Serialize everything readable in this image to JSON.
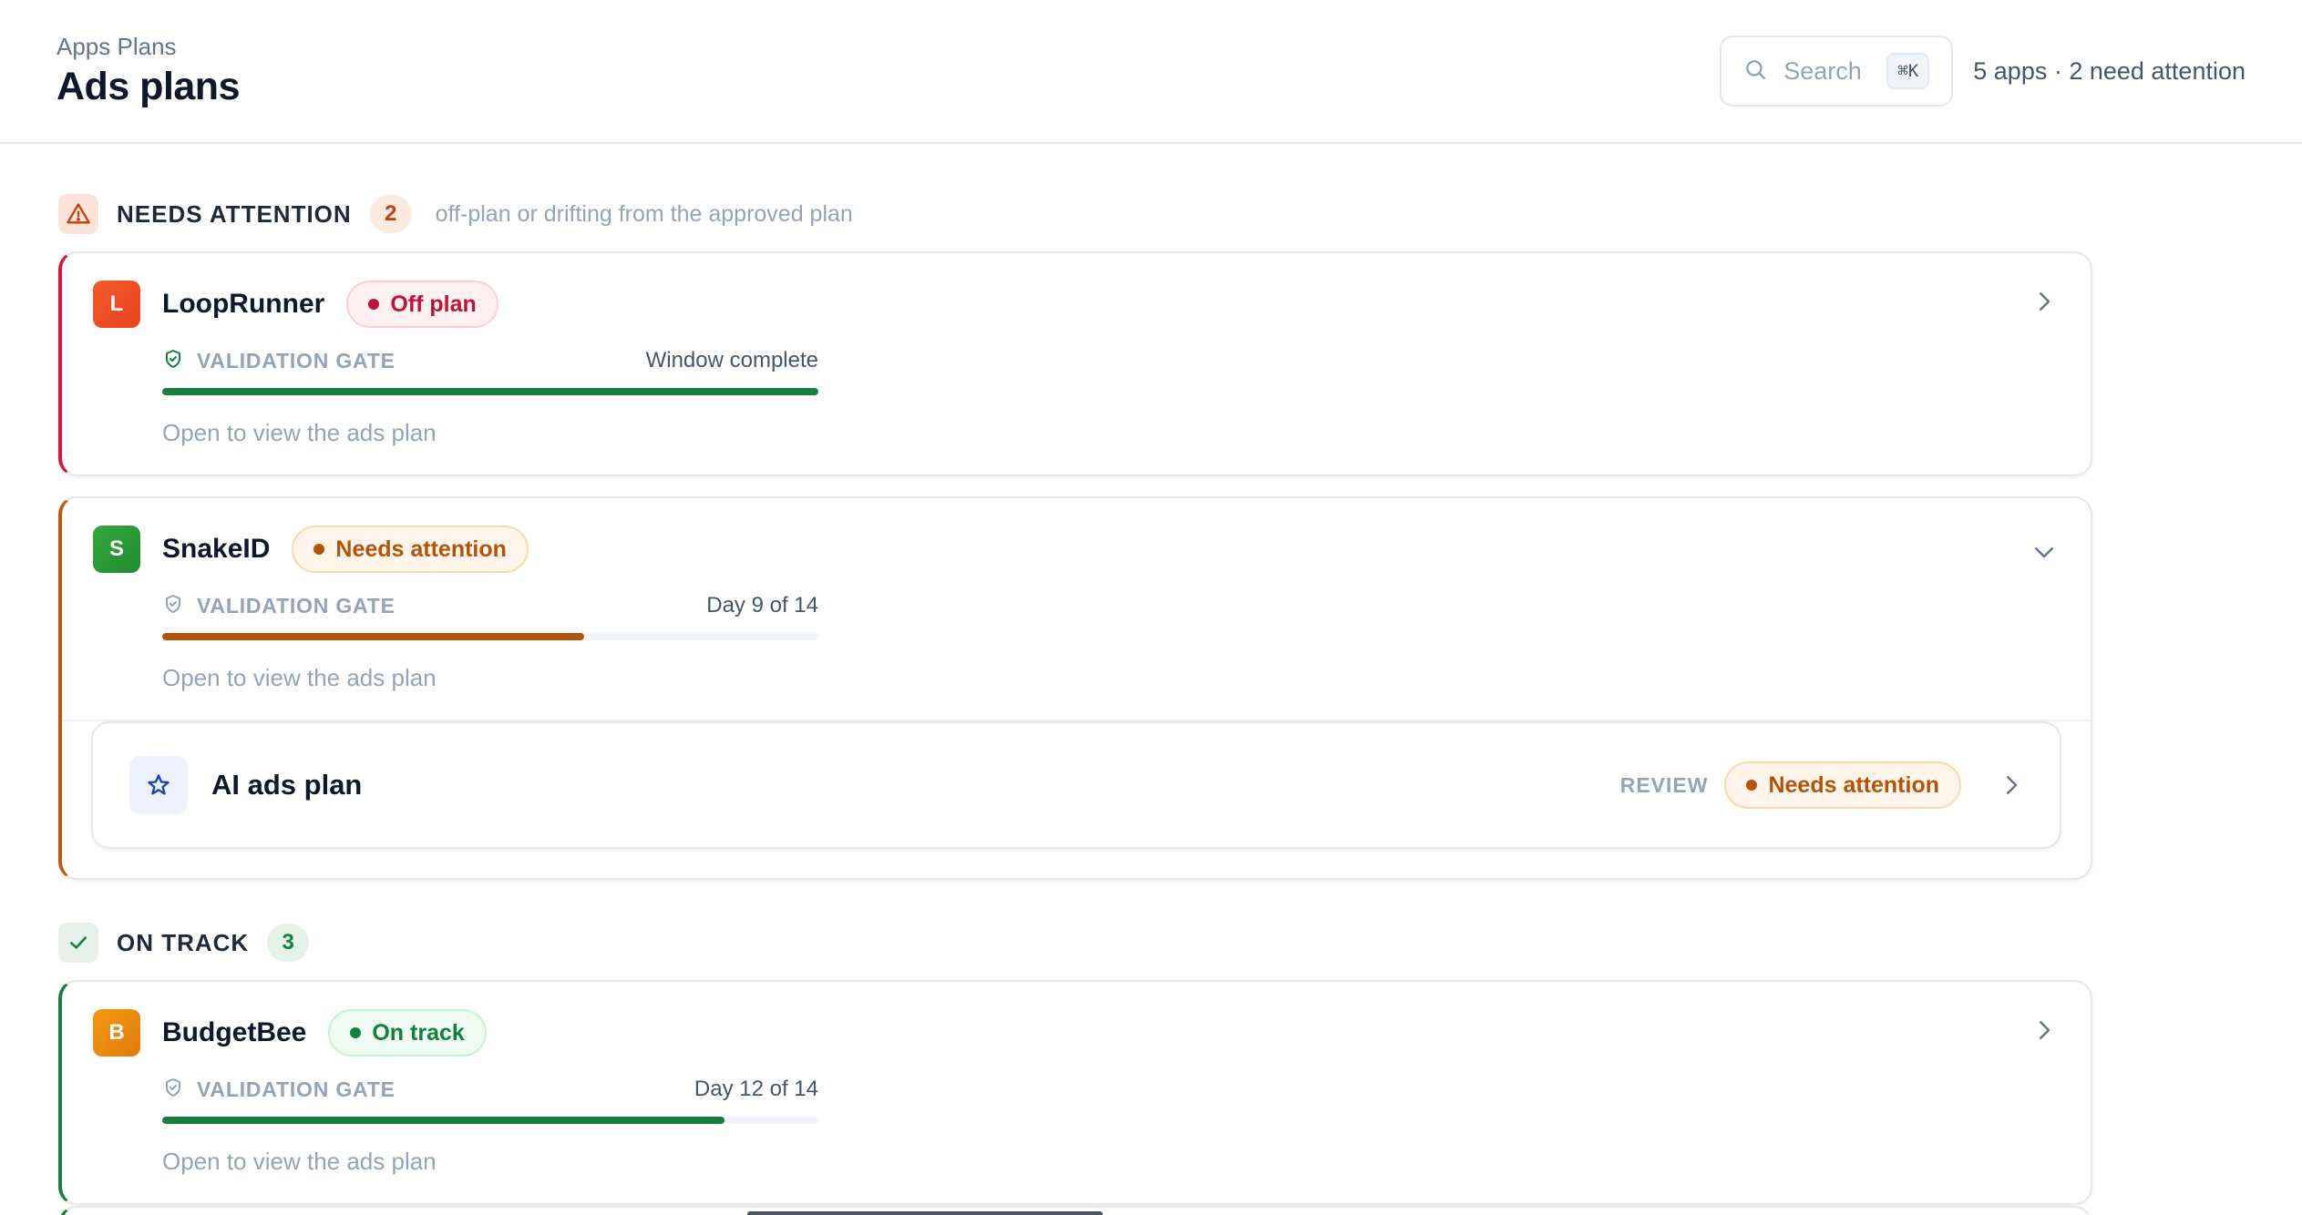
{
  "header": {
    "breadcrumb": "Apps Plans",
    "title": "Ads plans",
    "search_placeholder": "Search",
    "search_shortcut": "⌘K",
    "summary": "5 apps · 2 need attention"
  },
  "sections": {
    "attention": {
      "label": "NEEDS ATTENTION",
      "count": "2",
      "description": "off-plan or drifting from the approved plan"
    },
    "on_track": {
      "label": "ON TRACK",
      "count": "3"
    }
  },
  "apps": [
    {
      "initial": "L",
      "name": "LoopRunner",
      "status": "Off plan",
      "gate_label": "VALIDATION GATE",
      "gate_status": "Window complete",
      "progress": 1.0,
      "hint": "Open to view the ads plan",
      "icon_color": "#f0532b"
    },
    {
      "initial": "S",
      "name": "SnakeID",
      "status": "Needs attention",
      "gate_label": "VALIDATION GATE",
      "gate_status": "Day 9 of 14",
      "progress": 0.643,
      "hint": "Open to view the ads plan",
      "icon_color": "#2f9e3a",
      "plans": [
        {
          "title": "AI ads plan",
          "stage": "REVIEW",
          "status": "Needs attention"
        }
      ]
    },
    {
      "initial": "B",
      "name": "BudgetBee",
      "status": "On track",
      "gate_label": "VALIDATION GATE",
      "gate_status": "Day 12 of 14",
      "progress": 0.857,
      "hint": "Open to view the ads plan",
      "icon_color": "#f08a0e"
    }
  ]
}
